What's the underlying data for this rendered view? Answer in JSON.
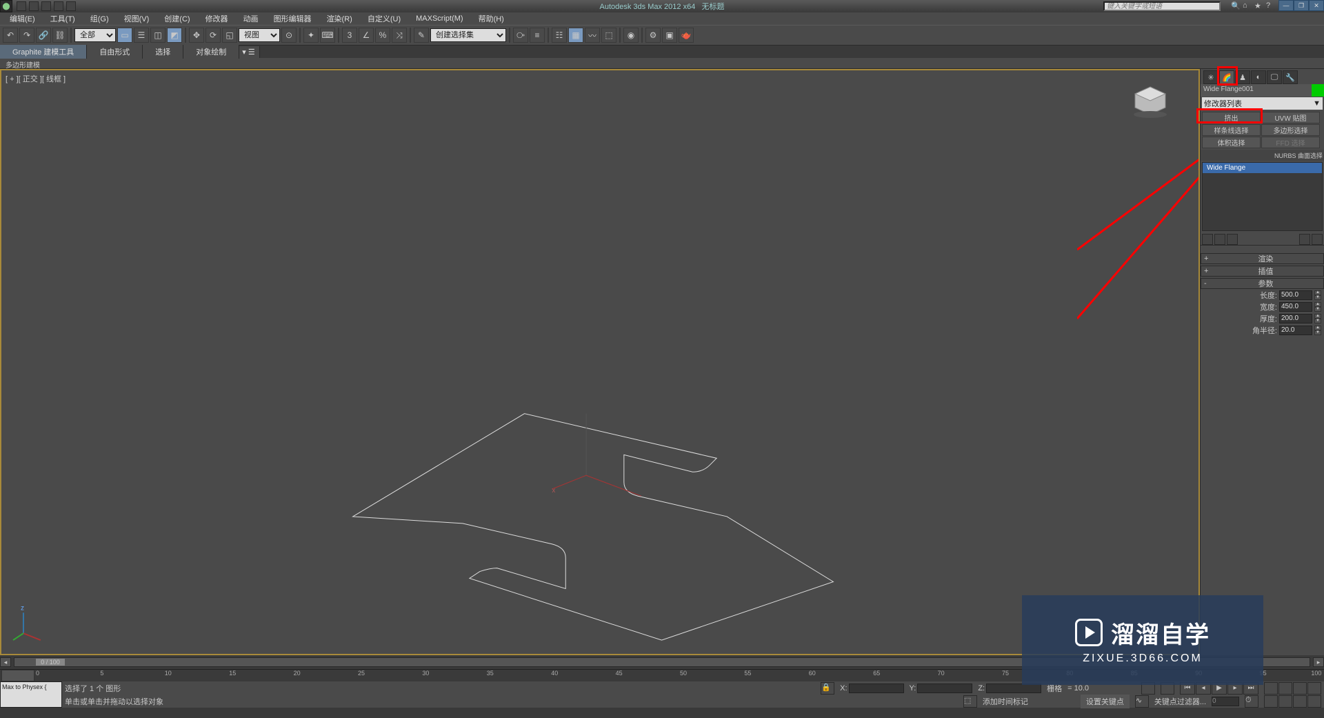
{
  "title": {
    "app": "Autodesk 3ds Max  2012  x64",
    "doc": "无标题",
    "search_placeholder": "键入关键字或短语"
  },
  "window_controls": {
    "min": "—",
    "max": "❐",
    "close": "✕"
  },
  "menu": [
    "编辑(E)",
    "工具(T)",
    "组(G)",
    "视图(V)",
    "创建(C)",
    "修改器",
    "动画",
    "图形编辑器",
    "渲染(R)",
    "自定义(U)",
    "MAXScript(M)",
    "帮助(H)"
  ],
  "toolbar": {
    "combo_all": "全部",
    "combo_view": "视图",
    "combo_selset": "创建选择集"
  },
  "ribbon": {
    "tabs": [
      "Graphite 建模工具",
      "自由形式",
      "选择",
      "对象绘制"
    ],
    "sub": "多边形建模"
  },
  "viewport": {
    "label": "[ + ][ 正交 ][ 线框 ]"
  },
  "cmdpanel": {
    "objname": "Wide Flange001",
    "modlist": "修改器列表",
    "buttons": {
      "extrude": "挤出",
      "uvwmap": "UVW 贴图",
      "spline": "样条线选择",
      "polysel": "多边形选择",
      "volsel": "体积选择",
      "ffd": "FFD 选择"
    },
    "nurbs": "NURBS 曲面选择",
    "stack_item": "Wide Flange",
    "rollouts": {
      "render": "渲染",
      "interp": "插值",
      "params": "参数"
    },
    "params": {
      "length_lbl": "长度:",
      "length_val": "500.0",
      "width_lbl": "宽度:",
      "width_val": "450.0",
      "thick_lbl": "厚度:",
      "thick_val": "200.0",
      "radius_lbl": "角半径:",
      "radius_val": "20.0"
    }
  },
  "timeline": {
    "pos": "0 / 100",
    "ticks": [
      "0",
      "5",
      "10",
      "15",
      "20",
      "25",
      "30",
      "35",
      "40",
      "45",
      "50",
      "55",
      "60",
      "65",
      "70",
      "75",
      "80",
      "85",
      "90",
      "95",
      "100"
    ]
  },
  "status": {
    "script": "Max to Physex {",
    "sel": "选择了 1 个 图形",
    "prompt": "单击或单击并拖动以选择对象",
    "x": "X:",
    "y": "Y:",
    "z": "Z:",
    "grid_lbl": "栅格",
    "grid_val": "= 10.0",
    "addtime": "添加时间标记",
    "setkey": "设置关键点",
    "keyfilter": "关键点过滤器..."
  },
  "watermark": {
    "main": "溜溜自学",
    "sub": "ZIXUE.3D66.COM"
  }
}
